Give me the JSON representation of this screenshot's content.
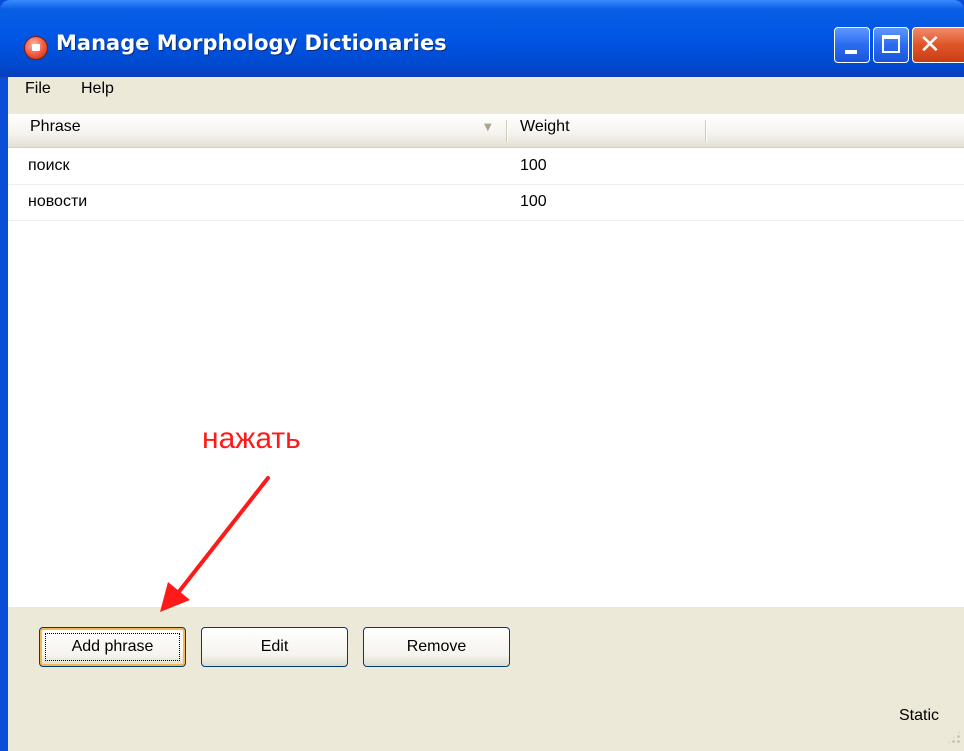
{
  "window": {
    "title": "Manage Morphology Dictionaries",
    "icons": {
      "app": "app-icon",
      "minimize": "minimize-icon",
      "maximize": "maximize-icon",
      "close": "close-icon"
    }
  },
  "menu": {
    "items": [
      "File",
      "Help"
    ]
  },
  "table": {
    "columns": [
      "Phrase",
      "Weight"
    ],
    "rows": [
      {
        "phrase": "поиск",
        "weight": "100"
      },
      {
        "phrase": "новости",
        "weight": "100"
      }
    ]
  },
  "buttons": {
    "add": "Add phrase",
    "edit": "Edit",
    "remove": "Remove"
  },
  "status": {
    "text": "Static"
  },
  "annotation": {
    "text": "нажать",
    "color": "#ff1a1a"
  },
  "colors": {
    "titlebar": "#0055e3",
    "client": "#ece9d8"
  }
}
